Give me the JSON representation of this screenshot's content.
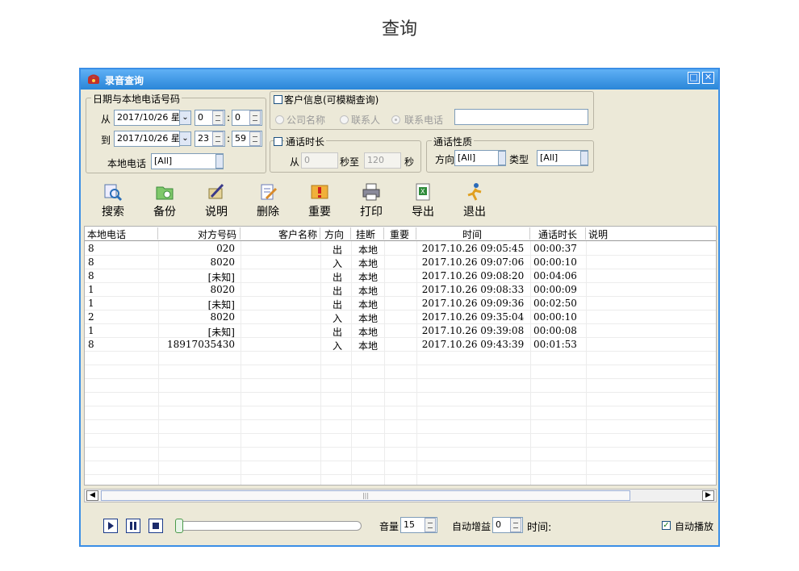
{
  "page_title": "查询",
  "window": {
    "title": "录音查询",
    "restore_icon": "restore-icon",
    "close_icon": "close-icon"
  },
  "date_group": {
    "label": "日期与本地电话号码",
    "from_label": "从",
    "from_date": "2017/10/26 星",
    "from_hour": "0",
    "from_min": "0",
    "to_label": "到",
    "to_date": "2017/10/26 星",
    "to_hour": "23",
    "to_min": "59",
    "colon": ":",
    "local_phone_label": "本地电话",
    "local_phone_value": "[All]"
  },
  "customer_group": {
    "label": "客户信息(可模糊查询)",
    "opt_company": "公司名称",
    "opt_contact": "联系人",
    "opt_phone": "联系电话",
    "search_value": ""
  },
  "duration_group": {
    "label": "通话时长",
    "from_label": "从",
    "from_value": "0",
    "mid_label": "秒至",
    "to_value": "120",
    "unit": "秒"
  },
  "nature_group": {
    "label": "通话性质",
    "direction_label": "方向",
    "direction_value": "[All]",
    "type_label": "类型",
    "type_value": "[All]"
  },
  "toolbar": [
    {
      "label": "搜索",
      "icon": "search-icon"
    },
    {
      "label": "备份",
      "icon": "backup-icon"
    },
    {
      "label": "说明",
      "icon": "note-icon"
    },
    {
      "label": "删除",
      "icon": "delete-icon"
    },
    {
      "label": "重要",
      "icon": "important-icon"
    },
    {
      "label": "打印",
      "icon": "print-icon"
    },
    {
      "label": "导出",
      "icon": "export-icon"
    },
    {
      "label": "退出",
      "icon": "exit-icon"
    }
  ],
  "table": {
    "columns": [
      "本地电话",
      "对方号码",
      "客户名称",
      "方向",
      "挂断",
      "重要",
      "时间",
      "通话时长",
      "说明"
    ],
    "rows": [
      [
        "8",
        "020",
        "",
        "出",
        "本地",
        "",
        "2017.10.26 09:05:45",
        "00:00:37",
        ""
      ],
      [
        "8",
        "8020",
        "",
        "入",
        "本地",
        "",
        "2017.10.26 09:07:06",
        "00:00:10",
        ""
      ],
      [
        "8",
        "[未知]",
        "",
        "出",
        "本地",
        "",
        "2017.10.26 09:08:20",
        "00:04:06",
        ""
      ],
      [
        "1",
        "8020",
        "",
        "出",
        "本地",
        "",
        "2017.10.26 09:08:33",
        "00:00:09",
        ""
      ],
      [
        "1",
        "[未知]",
        "",
        "出",
        "本地",
        "",
        "2017.10.26 09:09:36",
        "00:02:50",
        ""
      ],
      [
        "2",
        "8020",
        "",
        "入",
        "本地",
        "",
        "2017.10.26 09:35:04",
        "00:00:10",
        ""
      ],
      [
        "1",
        "[未知]",
        "",
        "出",
        "本地",
        "",
        "2017.10.26 09:39:08",
        "00:00:08",
        ""
      ],
      [
        "8",
        "18917035430",
        "",
        "入",
        "本地",
        "",
        "2017.10.26 09:43:39",
        "00:01:53",
        ""
      ]
    ]
  },
  "player": {
    "volume_label": "音量",
    "volume_value": "15",
    "gain_label": "自动增益",
    "gain_value": "0",
    "time_label": "时间:",
    "autoplay_label": "自动播放",
    "autoplay_checked": true,
    "progress": 0
  }
}
